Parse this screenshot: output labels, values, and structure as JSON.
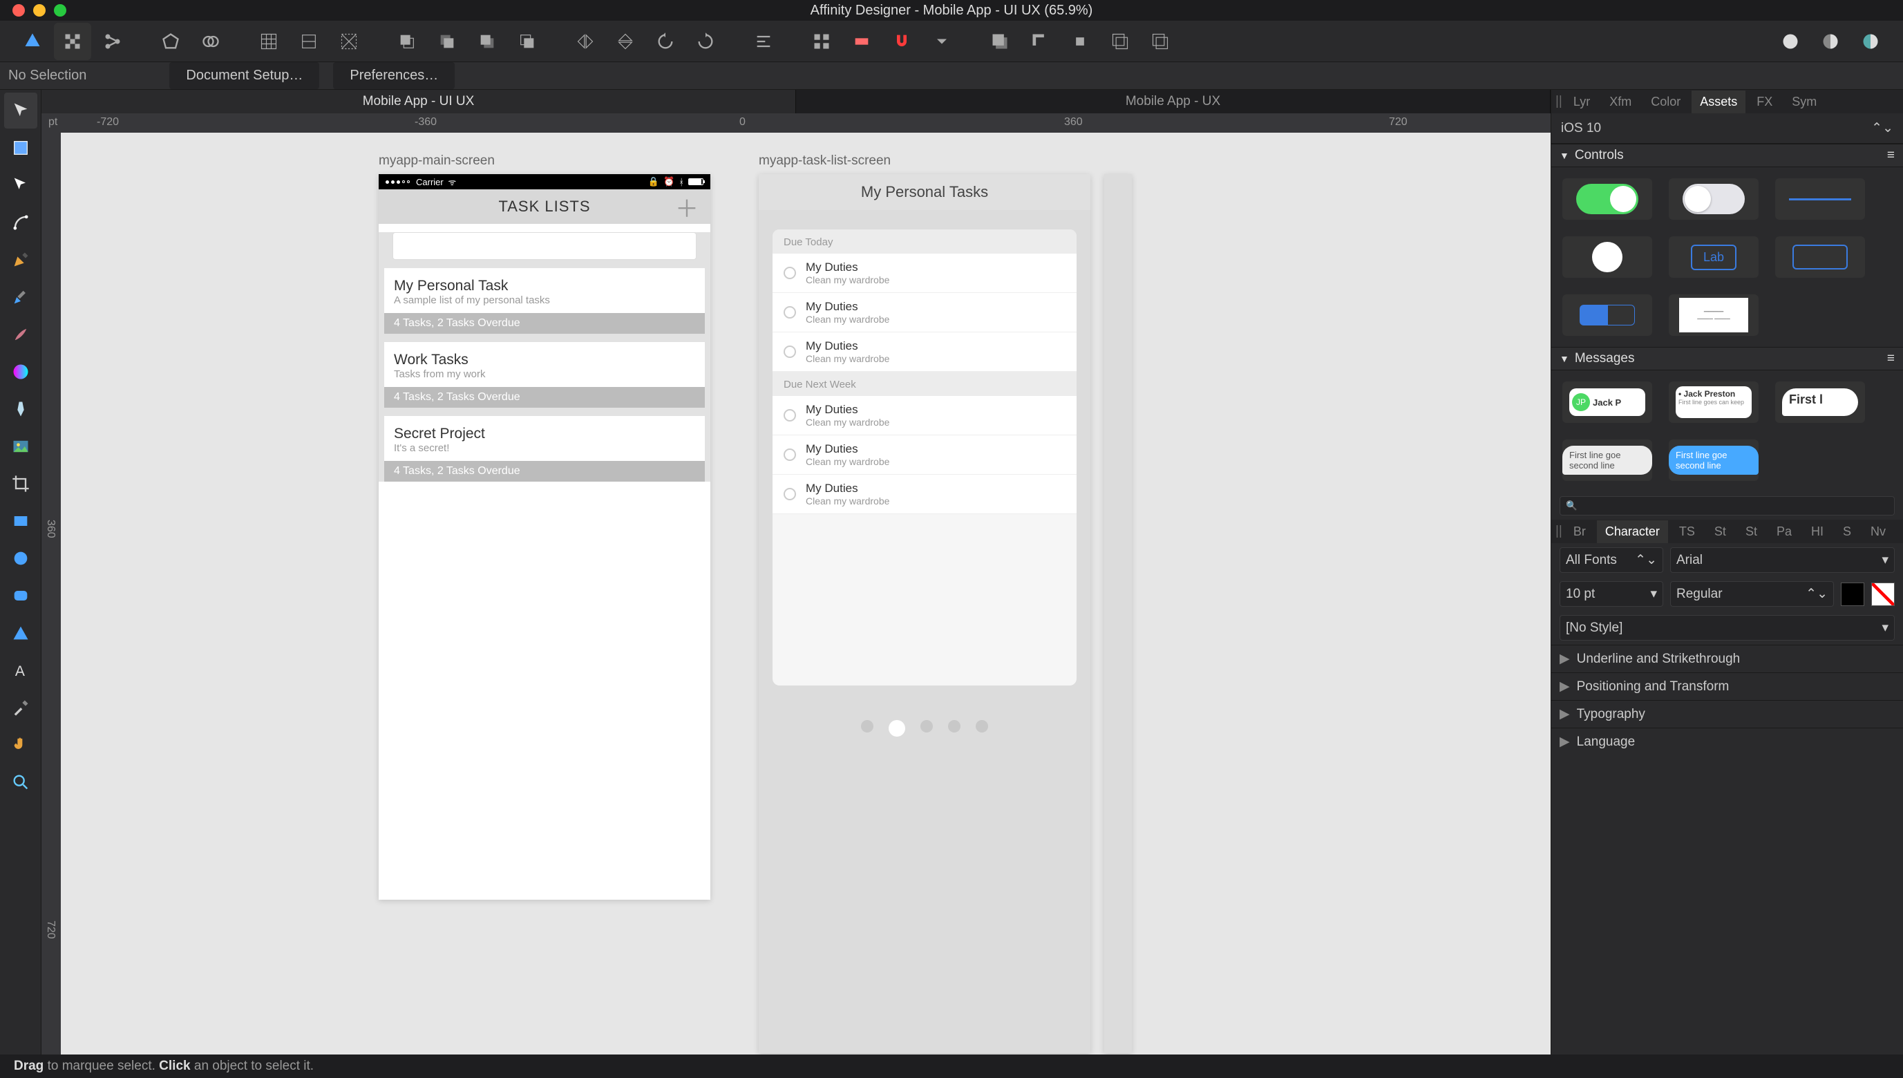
{
  "titlebar": {
    "title": "Affinity Designer - Mobile App - UI UX (65.9%)"
  },
  "context": {
    "no_selection": "No Selection",
    "doc_setup": "Document Setup…",
    "prefs": "Preferences…"
  },
  "doc_tabs": [
    "Mobile App - UI UX",
    "Mobile App - UX"
  ],
  "ruler": {
    "unit": "pt",
    "top": [
      "-720",
      "-360",
      "0",
      "360",
      "720"
    ],
    "left": [
      "360",
      "720"
    ]
  },
  "artboard1": {
    "label": "myapp-main-screen",
    "status_carrier": "Carrier",
    "header": "TASK LISTS",
    "cards": [
      {
        "title": "My Personal Task",
        "sub": "A sample list of my personal tasks",
        "footer": "4 Tasks, 2 Tasks Overdue"
      },
      {
        "title": "Work Tasks",
        "sub": "Tasks from my work",
        "footer": "4 Tasks, 2 Tasks Overdue"
      },
      {
        "title": "Secret Project",
        "sub": "It's a secret!",
        "footer": "4 Tasks, 2 Tasks Overdue"
      }
    ]
  },
  "artboard2": {
    "label": "myapp-task-list-screen",
    "header": "My Personal Tasks",
    "sections": [
      {
        "title": "Due Today",
        "rows": [
          {
            "t1": "My Duties",
            "t2": "Clean my wardrobe"
          },
          {
            "t1": "My Duties",
            "t2": "Clean my wardrobe"
          },
          {
            "t1": "My Duties",
            "t2": "Clean my wardrobe"
          }
        ]
      },
      {
        "title": "Due Next Week",
        "rows": [
          {
            "t1": "My Duties",
            "t2": "Clean my wardrobe"
          },
          {
            "t1": "My Duties",
            "t2": "Clean my wardrobe"
          },
          {
            "t1": "My Duties",
            "t2": "Clean my wardrobe"
          }
        ]
      }
    ]
  },
  "right": {
    "tabs1": [
      "Lyr",
      "Xfm",
      "Color",
      "Assets",
      "FX",
      "Sym"
    ],
    "tabs1_active": "Assets",
    "preset": "iOS 10",
    "section_controls": "Controls",
    "section_messages": "Messages",
    "btn_label": "Lab",
    "msg_jack": "Jack P",
    "msg_jack2": "Jack Preston",
    "msg_jack2_sub": "First line goes can keep",
    "msg_first": "First l",
    "bubble1": "First line goe second line",
    "bubble2": "First line goe second line",
    "search_placeholder": "",
    "tabs2": [
      "Br",
      "Character",
      "TS",
      "St",
      "St",
      "Pa",
      "HI",
      "S",
      "Nv"
    ],
    "tabs2_active": "Character",
    "font_filter": "All Fonts",
    "font_family": "Arial",
    "font_size": "10 pt",
    "font_weight": "Regular",
    "font_style": "[No Style]",
    "rows": [
      "Underline and Strikethrough",
      "Positioning and Transform",
      "Typography",
      "Language"
    ]
  },
  "status": {
    "drag": "Drag",
    "drag_t": " to marquee select. ",
    "click": "Click",
    "click_t": " an object to select it."
  }
}
